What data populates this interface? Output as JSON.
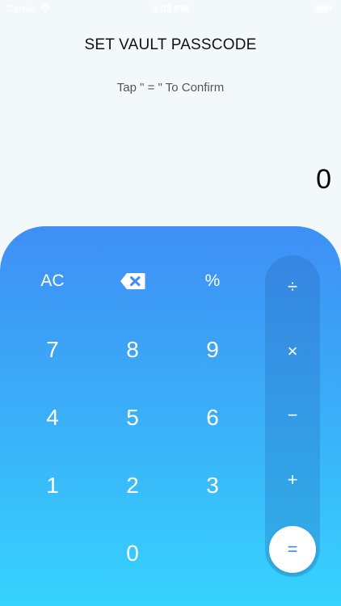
{
  "status_bar": {
    "carrier": "Carrier",
    "time": "9:03 PM"
  },
  "header": {
    "title": "SET VAULT PASSCODE",
    "subtitle": "Tap \" = \" To Confirm"
  },
  "display": {
    "value": "0"
  },
  "keypad": {
    "ac": "AC",
    "percent": "%",
    "digits": {
      "seven": "7",
      "eight": "8",
      "nine": "9",
      "four": "4",
      "five": "5",
      "six": "6",
      "one": "1",
      "two": "2",
      "three": "3",
      "zero": "0"
    },
    "operators": {
      "divide": "÷",
      "multiply": "×",
      "subtract": "−",
      "add": "+",
      "equals": "="
    }
  },
  "colors": {
    "keypad_gradient_top": "#3f8ff5",
    "keypad_gradient_bottom": "#36d3fd",
    "background": "#f3f9fb"
  }
}
